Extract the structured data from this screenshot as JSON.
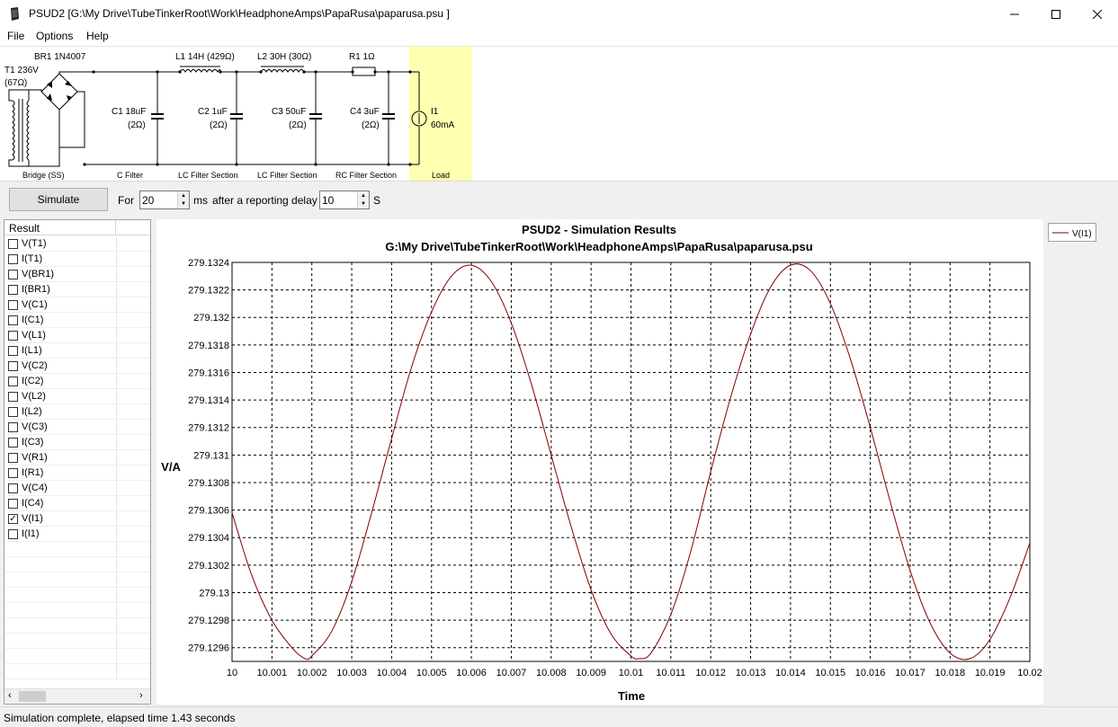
{
  "window": {
    "title": "PSUD2  [G:\\My Drive\\TubeTinkerRoot\\Work\\HeadphoneAmps\\PapaRusa\\paparusa.psu ]"
  },
  "menu": [
    "File",
    "Options",
    "Help"
  ],
  "schematic": {
    "transformer": {
      "label1": "T1 236V",
      "label2": "(67Ω)"
    },
    "rectifier": "BR1 1N4007",
    "c1": {
      "label1": "C1 18uF",
      "label2": "(2Ω)"
    },
    "l1": "L1 14H (429Ω)",
    "c2": {
      "label1": "C2 1uF",
      "label2": "(2Ω)"
    },
    "l2": "L2 30H (30Ω)",
    "c3": {
      "label1": "C3 50uF",
      "label2": "(2Ω)"
    },
    "r1": "R1 1Ω",
    "c4": {
      "label1": "C4 3uF",
      "label2": "(2Ω)"
    },
    "load": {
      "label1": "I1",
      "label2": "60mA"
    },
    "sections": [
      "Bridge (SS)",
      "C Filter",
      "LC Filter Section",
      "LC Filter Section",
      "RC Filter Section",
      "Load"
    ],
    "load_highlight": "#ffffb0"
  },
  "toolbar": {
    "simulate_label": "Simulate",
    "for_label": "For",
    "duration_value": "20",
    "ms_label": "ms",
    "delay_label": "after a reporting delay of",
    "delay_value": "10",
    "s_label": "S"
  },
  "results": {
    "header": "Result",
    "items": [
      {
        "label": "V(T1)",
        "checked": false
      },
      {
        "label": "I(T1)",
        "checked": false
      },
      {
        "label": "V(BR1)",
        "checked": false
      },
      {
        "label": "I(BR1)",
        "checked": false
      },
      {
        "label": "V(C1)",
        "checked": false
      },
      {
        "label": "I(C1)",
        "checked": false
      },
      {
        "label": "V(L1)",
        "checked": false
      },
      {
        "label": "I(L1)",
        "checked": false
      },
      {
        "label": "V(C2)",
        "checked": false
      },
      {
        "label": "I(C2)",
        "checked": false
      },
      {
        "label": "V(L2)",
        "checked": false
      },
      {
        "label": "I(L2)",
        "checked": false
      },
      {
        "label": "V(C3)",
        "checked": false
      },
      {
        "label": "I(C3)",
        "checked": false
      },
      {
        "label": "V(R1)",
        "checked": false
      },
      {
        "label": "I(R1)",
        "checked": false
      },
      {
        "label": "V(C4)",
        "checked": false
      },
      {
        "label": "I(C4)",
        "checked": false
      },
      {
        "label": "V(I1)",
        "checked": true
      },
      {
        "label": "I(I1)",
        "checked": false
      }
    ]
  },
  "status": "Simulation complete, elapsed time 1.43 seconds",
  "chart_data": {
    "type": "line",
    "title": "PSUD2 - Simulation Results",
    "subtitle": "G:\\My Drive\\TubeTinkerRoot\\Work\\HeadphoneAmps\\PapaRusa\\paparusa.psu",
    "xlabel": "Time",
    "ylabel": "V/A",
    "xlim": [
      10,
      10.02
    ],
    "ylim": [
      279.1295,
      279.1324
    ],
    "x_ticks": [
      "10",
      "10.001",
      "10.002",
      "10.003",
      "10.004",
      "10.005",
      "10.006",
      "10.007",
      "10.008",
      "10.009",
      "10.01",
      "10.011",
      "10.012",
      "10.013",
      "10.014",
      "10.015",
      "10.016",
      "10.017",
      "10.018",
      "10.019",
      "10.02"
    ],
    "y_ticks": [
      "279.1296",
      "279.1298",
      "279.13",
      "279.1302",
      "279.1304",
      "279.1306",
      "279.1308",
      "279.131",
      "279.1312",
      "279.1314",
      "279.1316",
      "279.1318",
      "279.132",
      "279.1322",
      "279.1324"
    ],
    "grid": true,
    "legend": "top-right",
    "series": [
      {
        "name": "V(I1)",
        "color": "#800000",
        "x": [
          10.0,
          10.0005,
          10.001,
          10.0015,
          10.00183,
          10.002,
          10.0025,
          10.003,
          10.0035,
          10.004,
          10.0045,
          10.005,
          10.0055,
          10.006,
          10.0065,
          10.007,
          10.0075,
          10.008,
          10.0085,
          10.009,
          10.0095,
          10.01,
          10.0102,
          10.0105,
          10.011,
          10.0115,
          10.012,
          10.0125,
          10.013,
          10.0135,
          10.014,
          10.0145,
          10.015,
          10.0155,
          10.016,
          10.0165,
          10.017,
          10.0175,
          10.018,
          10.0185,
          10.019,
          10.0195,
          10.02
        ],
        "y": [
          279.13058,
          279.13012,
          279.1298,
          279.1296,
          279.12952,
          279.12954,
          279.12972,
          279.13008,
          279.13058,
          279.13112,
          279.13164,
          279.13204,
          279.1323,
          279.13238,
          279.13226,
          279.13196,
          279.13152,
          279.131,
          279.13048,
          279.13002,
          279.1297,
          279.12954,
          279.12952,
          279.12956,
          279.12984,
          279.1303,
          279.13088,
          279.13142,
          279.13188,
          279.13222,
          279.13238,
          279.13234,
          279.1321,
          279.1317,
          279.1312,
          279.13066,
          279.13016,
          279.12978,
          279.12956,
          279.12952,
          279.12966,
          279.12996,
          279.13036
        ]
      }
    ]
  }
}
